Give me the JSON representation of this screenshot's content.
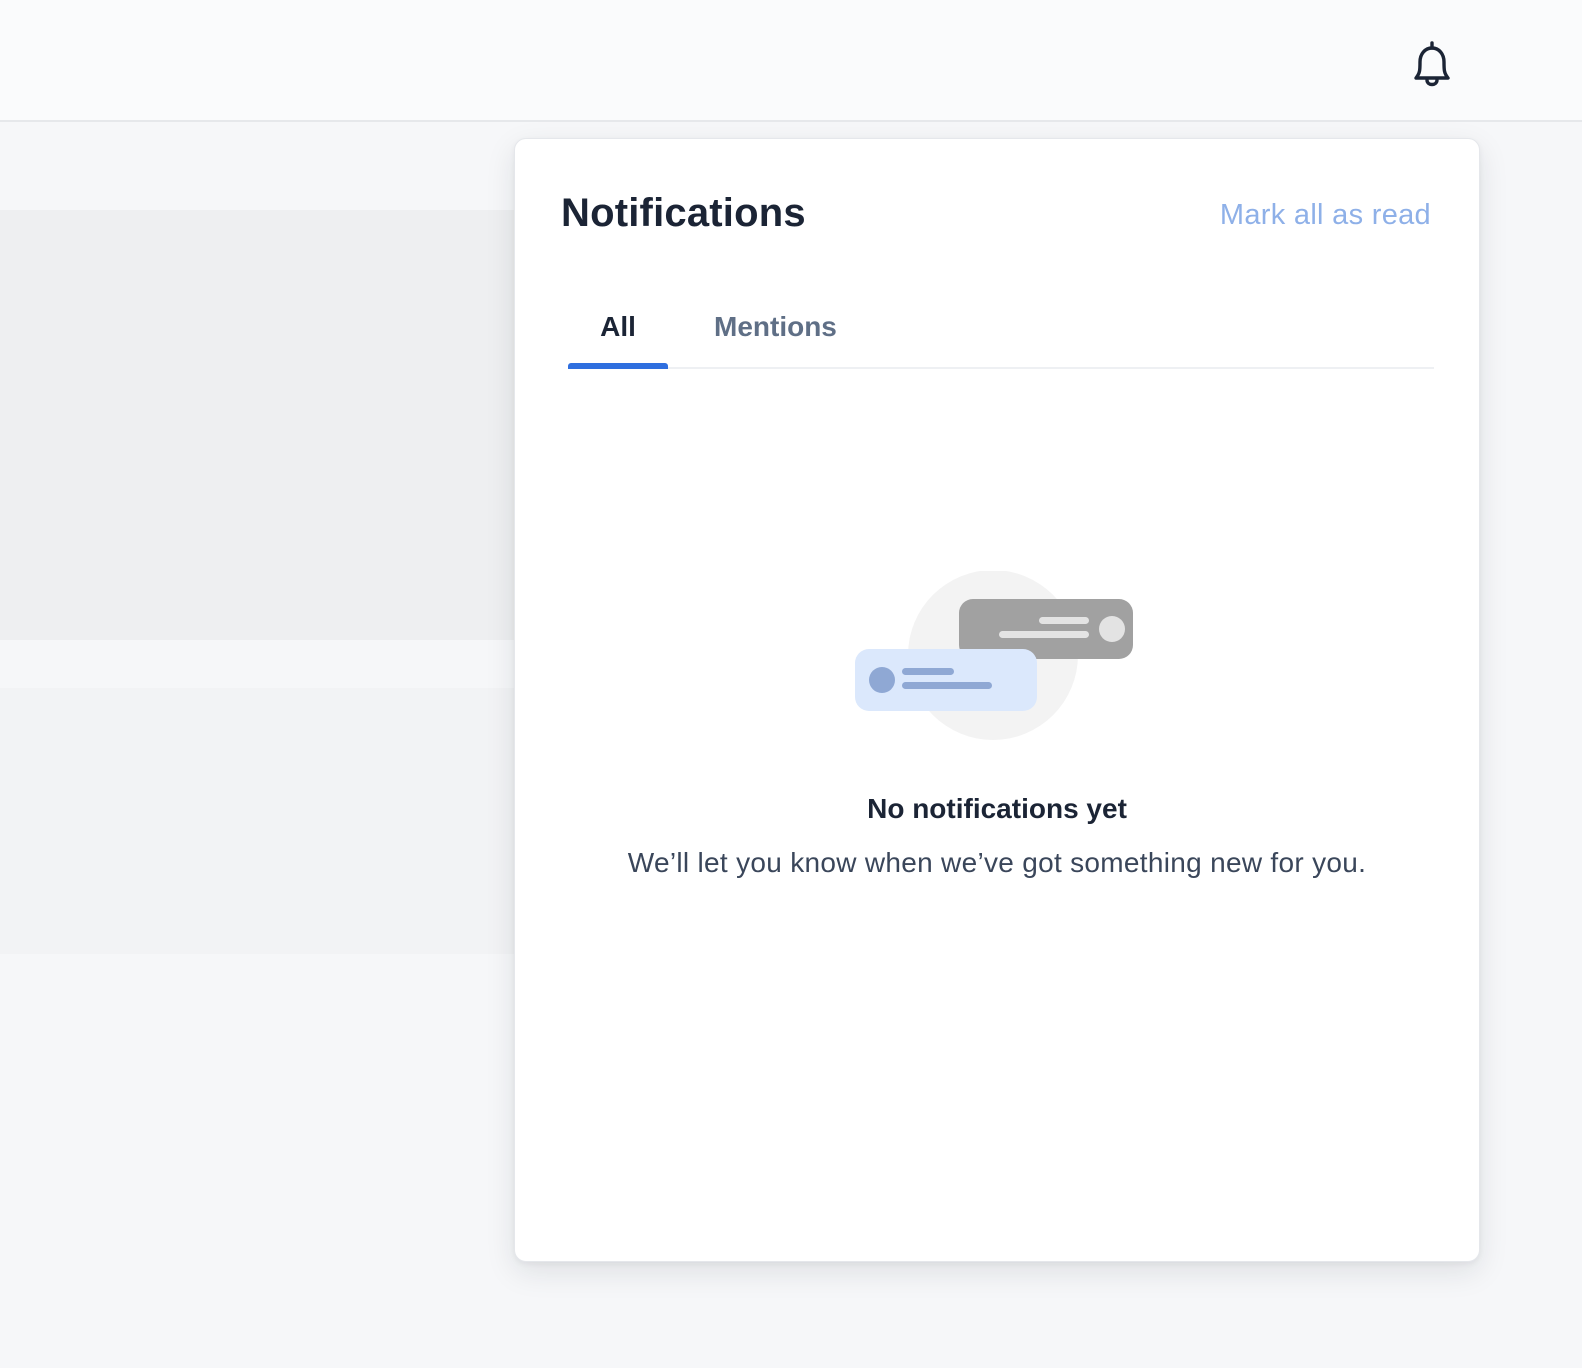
{
  "header": {
    "notifications_icon": "bell-icon"
  },
  "panel": {
    "title": "Notifications",
    "mark_all_read": "Mark all as read",
    "tabs": [
      {
        "label": "All",
        "active": true
      },
      {
        "label": "Mentions",
        "active": false
      }
    ],
    "empty_state": {
      "illustration": "chat-bubbles-illustration",
      "title": "No notifications yet",
      "message": "We’ll let you know when we’ve got something new for you."
    }
  },
  "colors": {
    "accent": "#2f6fdf",
    "link": "#8eb0e8",
    "text_primary": "#1b2435",
    "text_secondary": "#5f6f86"
  }
}
